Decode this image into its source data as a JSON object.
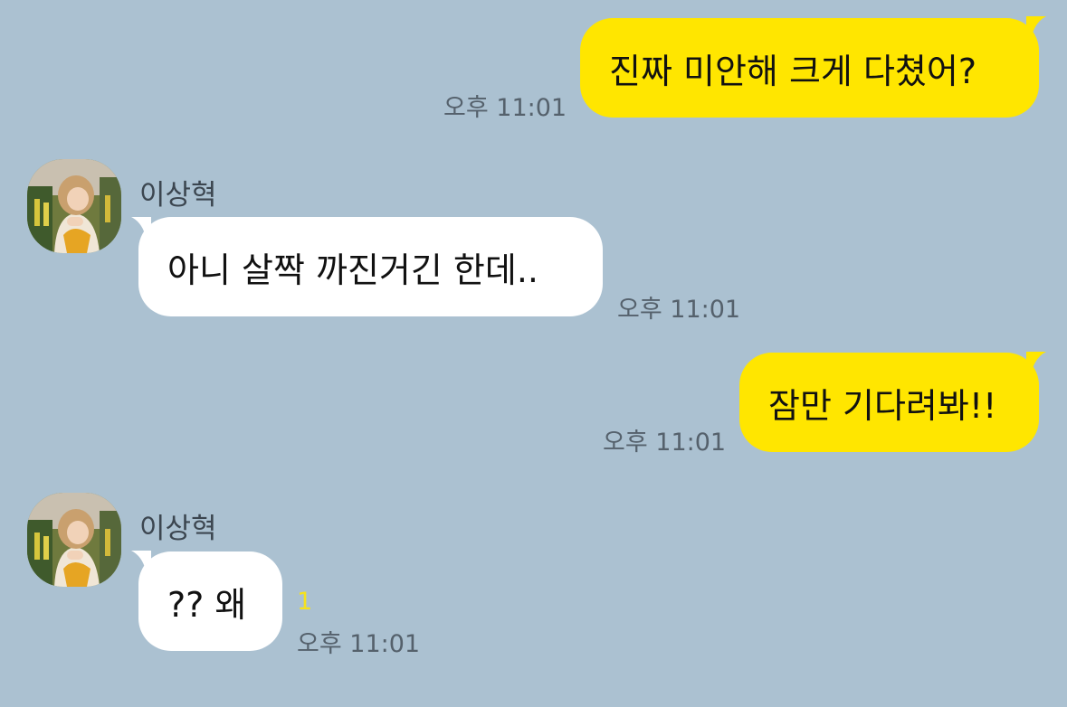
{
  "theme": {
    "background": "#abc1d1",
    "outgoing_bubble": "#ffe600",
    "incoming_bubble": "#ffffff",
    "unread_color": "#f5e21d"
  },
  "messages": [
    {
      "direction": "outgoing",
      "text": "진짜 미안해 크게 다쳤어?",
      "time": "오후 11:01"
    },
    {
      "direction": "incoming",
      "sender": "이상혁",
      "avatar_icon": "profile-photo-avatar",
      "text": "아니 살짝 까진거긴 한데..",
      "time": "오후 11:01"
    },
    {
      "direction": "outgoing",
      "text": "잠만 기다려봐!!",
      "time": "오후 11:01"
    },
    {
      "direction": "incoming",
      "sender": "이상혁",
      "avatar_icon": "profile-photo-avatar",
      "text": "?? 왜",
      "time": "오후 11:01",
      "unread": "1"
    }
  ]
}
